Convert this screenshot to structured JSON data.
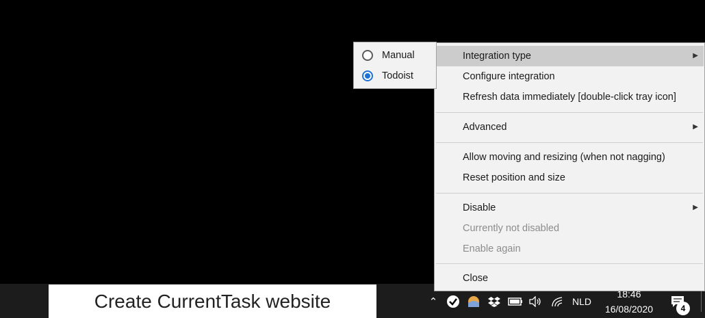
{
  "taskbar": {
    "task_title": "Create CurrentTask website",
    "language": "NLD",
    "time": "18:46",
    "date": "16/08/2020",
    "notification_count": "4"
  },
  "submenu": {
    "items": [
      {
        "label": "Manual",
        "selected": false
      },
      {
        "label": "Todoist",
        "selected": true
      }
    ]
  },
  "menu": {
    "items": [
      {
        "label": "Integration type",
        "submenu": true,
        "highlighted": true
      },
      {
        "label": "Configure integration"
      },
      {
        "label": "Refresh data immediately [double-click tray icon]"
      },
      {
        "label": "Advanced",
        "submenu": true
      },
      {
        "label": "Allow moving and resizing (when not nagging)"
      },
      {
        "label": "Reset position and size"
      },
      {
        "label": "Disable",
        "submenu": true
      },
      {
        "label": "Currently not disabled",
        "disabled": true
      },
      {
        "label": "Enable again",
        "disabled": true
      },
      {
        "label": "Close"
      }
    ]
  },
  "colors": {
    "radio_accent": "#1e72d4",
    "menu_bg": "#f2f2f2",
    "highlight_bg": "#cccccc",
    "disabled_text": "#8c8c8c"
  }
}
